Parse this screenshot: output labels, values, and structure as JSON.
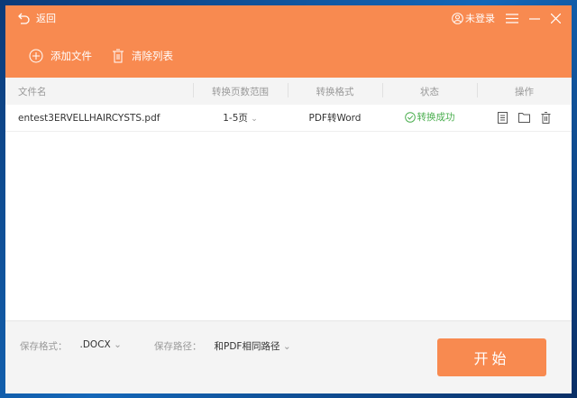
{
  "header": {
    "back": "返回",
    "user": "未登录"
  },
  "toolbar": {
    "add": "添加文件",
    "clear": "清除列表"
  },
  "table": {
    "columns": [
      "文件名",
      "转换页数范围",
      "转换格式",
      "状态",
      "操作"
    ],
    "rows": [
      {
        "name": "entest3ERVELLHAIRCYSTS.pdf",
        "range": "1-5页",
        "format": "PDF转Word",
        "status": "转换成功"
      }
    ]
  },
  "footer": {
    "format_label": "保存格式：",
    "format_value": ".DOCX",
    "path_label": "保存路径：",
    "path_value": "和PDF相同路径",
    "start": "开始"
  },
  "colors": {
    "accent": "#f88a50",
    "success": "#4caf50"
  }
}
